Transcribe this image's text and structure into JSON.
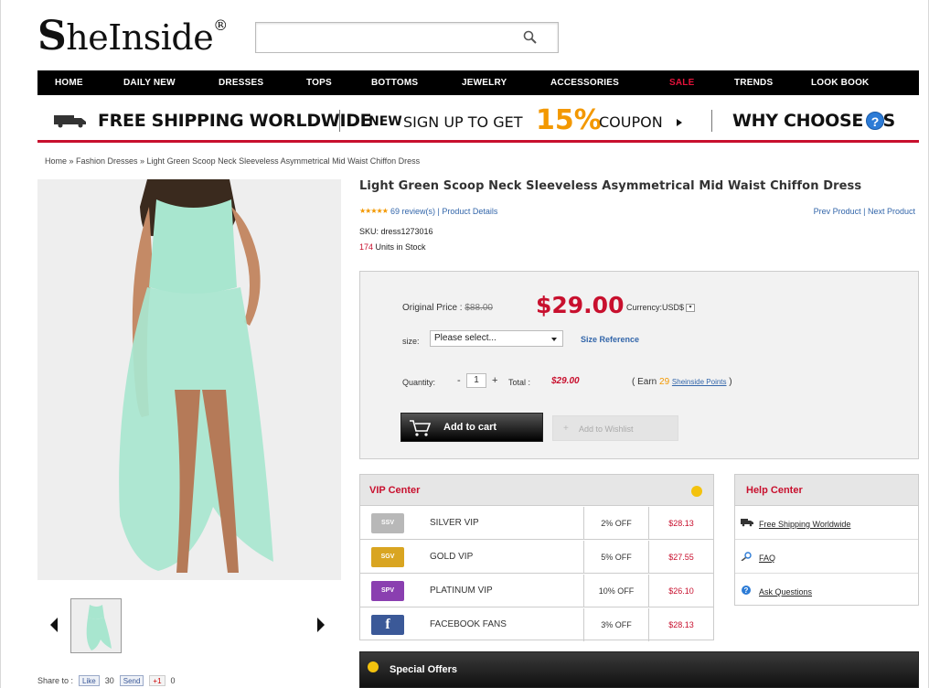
{
  "header": {
    "logo": {
      "s": "S",
      "rest": "heInside",
      "reg": "®"
    },
    "search_placeholder": ""
  },
  "nav": {
    "items": [
      "HOME",
      "DAILY NEW",
      "DRESSES",
      "TOPS",
      "BOTTOMS",
      "JEWELRY",
      "ACCESSORIES",
      "SALE",
      "TRENDS",
      "LOOK BOOK"
    ]
  },
  "promo": {
    "shipping": "FREE SHIPPING WORLDWIDE",
    "signup_new": "NEW",
    "signup_text": "SIGN UP TO GET",
    "signup_pct": "15%",
    "signup_coupon": "COUPON",
    "why": "WHY CHOOSE US",
    "help_icon_glyph": "?"
  },
  "breadcrumb": "Home » Fashion Dresses » Light Green Scoop Neck Sleeveless Asymmetrical Mid Waist Chiffon Dress",
  "product": {
    "title": "Light Green Scoop Neck Sleeveless Asymmetrical Mid Waist Chiffon Dress",
    "stars": "★★★★★",
    "reviews": "69 review(s) | Product Details",
    "prev_next": "Prev Product | Next Product",
    "sku": "SKU: dress1273016",
    "stock_num": "174",
    "stock_text": " Units in Stock"
  },
  "purchase": {
    "original_label": "Original Price :",
    "original_price": "$88.00",
    "price": "$29.00",
    "currency": "Currency:USD$",
    "size_label": "size:",
    "size_selected": "Please select...",
    "size_reference": "Size Reference",
    "quantity_label": "Quantity:",
    "quantity_minus": "-",
    "quantity_value": "1",
    "quantity_plus": "+",
    "total_label": "Total :",
    "total_value": "$29.00",
    "earn_prefix": "( Earn",
    "earn_points": "29",
    "earn_link": "Sheinside Points",
    "earn_suffix": ")",
    "add_to_cart": "Add to cart",
    "add_to_wishlist": "Add to Wishlist"
  },
  "vip": {
    "title": "VIP Center",
    "rows": [
      {
        "badge": "SSV",
        "name": "SILVER VIP",
        "off": "2% OFF",
        "price": "$28.13",
        "color": "#b8b8b8"
      },
      {
        "badge": "SGV",
        "name": "GOLD VIP",
        "off": "5% OFF",
        "price": "$27.55",
        "color": "#d9a521"
      },
      {
        "badge": "SPV",
        "name": "PLATINUM VIP",
        "off": "10% OFF",
        "price": "$26.10",
        "color": "#8a3fb0"
      },
      {
        "badge": "f",
        "name": "FACEBOOK FANS",
        "off": "3% OFF",
        "price": "$28.13",
        "color": "#3b5998"
      }
    ]
  },
  "help": {
    "title": "Help Center",
    "links": [
      "Free Shipping Worldwide",
      "FAQ",
      "Ask Questions"
    ]
  },
  "share": {
    "label": "Share to :",
    "like": "Like",
    "like_count": "30",
    "send": "Send",
    "gplus": "+1",
    "gplus_count": "0"
  },
  "special_offers": "Special Offers",
  "colors": {
    "accent_red": "#c8102e",
    "coupon_orange": "#f39800",
    "link_blue": "#3366aa",
    "dress_mint": "#a8e6cf"
  }
}
